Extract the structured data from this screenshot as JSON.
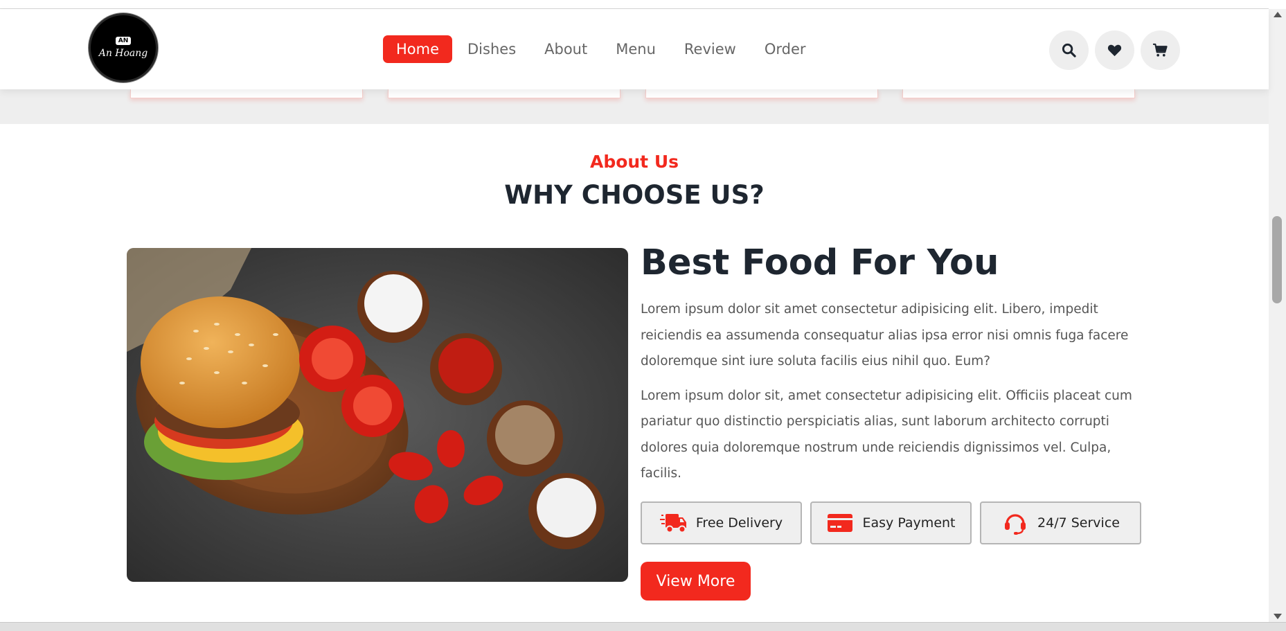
{
  "brand": {
    "logo_badge": "AN",
    "logo_text": "An Hoang"
  },
  "nav": {
    "items": [
      "Home",
      "Dishes",
      "About",
      "Menu",
      "Review",
      "Order"
    ],
    "active": "Home"
  },
  "header_icons": [
    "search-icon",
    "heart-icon",
    "cart-icon"
  ],
  "about": {
    "label": "About Us",
    "title": "WHY CHOOSE US?",
    "heading": "Best Food For You",
    "paragraph_1": "Lorem ipsum dolor sit amet consectetur adipisicing elit. Libero, impedit reiciendis ea assumenda consequatur alias ipsa error nisi omnis fuga facere doloremque sint iure soluta facilis eius nihil quo. Eum?",
    "paragraph_2": "Lorem ipsum dolor sit, amet consectetur adipisicing elit. Officiis placeat cum pariatur quo distinctio perspiciatis alias, sunt laborum architecto corrupti dolores quia doloremque nostrum unde reiciendis dignissimos vel. Culpa, facilis.",
    "features": [
      {
        "label": "Free Delivery",
        "icon": "truck-icon"
      },
      {
        "label": "Easy Payment",
        "icon": "credit-card-icon"
      },
      {
        "label": "24/7 Service",
        "icon": "headset-icon"
      }
    ],
    "button_label": "View More"
  },
  "colors": {
    "accent": "#f2291e",
    "heading": "#1e2630",
    "text": "#555555",
    "band": "#eeeeee"
  }
}
